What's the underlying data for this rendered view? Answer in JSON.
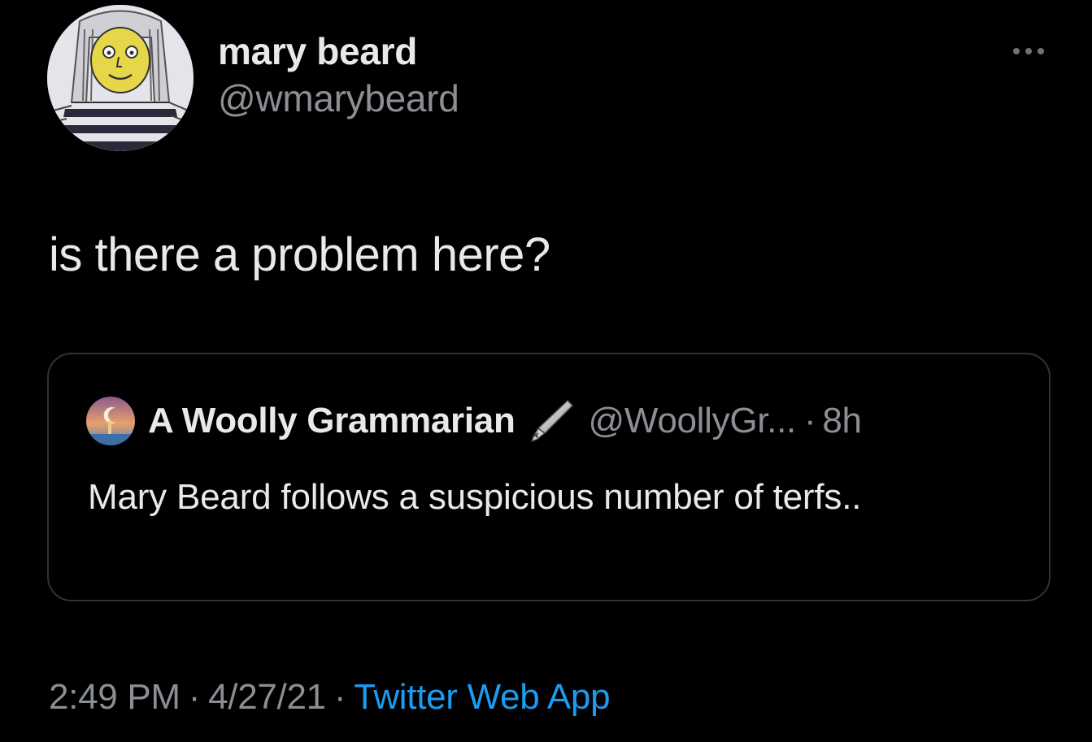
{
  "author": {
    "display_name": "mary beard",
    "handle": "@wmarybeard",
    "avatar_icon": "drawn-portrait-avatar"
  },
  "more_icon": "more-options-icon",
  "tweet": {
    "text": "is there a problem here?"
  },
  "quoted_tweet": {
    "display_name": "A Woolly Grammarian",
    "name_emoji_icon": "fountain-pen-icon",
    "handle": "@WoollyGr...",
    "separator": "·",
    "time": "8h",
    "text": "Mary Beard follows a suspicious number of terfs..",
    "avatar_icon": "moon-landscape-avatar"
  },
  "meta": {
    "time": "2:49 PM",
    "separator": "·",
    "date": "4/27/21",
    "source": "Twitter Web App"
  },
  "colors": {
    "background": "#000000",
    "text_primary": "#e7e9ea",
    "text_secondary": "#8b8f94",
    "link": "#1d9bf0",
    "border": "#2f3336"
  }
}
